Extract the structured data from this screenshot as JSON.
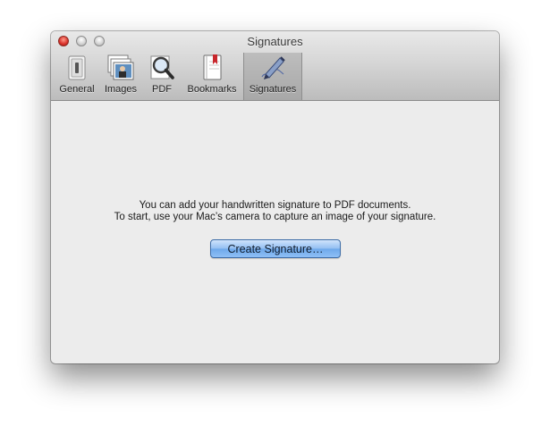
{
  "window": {
    "title": "Signatures"
  },
  "toolbar": {
    "tabs": [
      {
        "label": "General",
        "icon": "switch-icon"
      },
      {
        "label": "Images",
        "icon": "photos-icon"
      },
      {
        "label": "PDF",
        "icon": "magnifier-icon"
      },
      {
        "label": "Bookmarks",
        "icon": "bookmark-icon"
      },
      {
        "label": "Signatures",
        "icon": "pen-signature-icon"
      }
    ],
    "active_tab": "Signatures"
  },
  "content": {
    "message_line1": "You can add your handwritten signature to PDF documents.",
    "message_line2": "To start, use your Mac’s camera to capture an image of your signature.",
    "create_button_label": "Create Signature…"
  },
  "colors": {
    "button_blue": "#8fc0f6",
    "close_red": "#d9302a",
    "content_bg": "#ececec"
  }
}
